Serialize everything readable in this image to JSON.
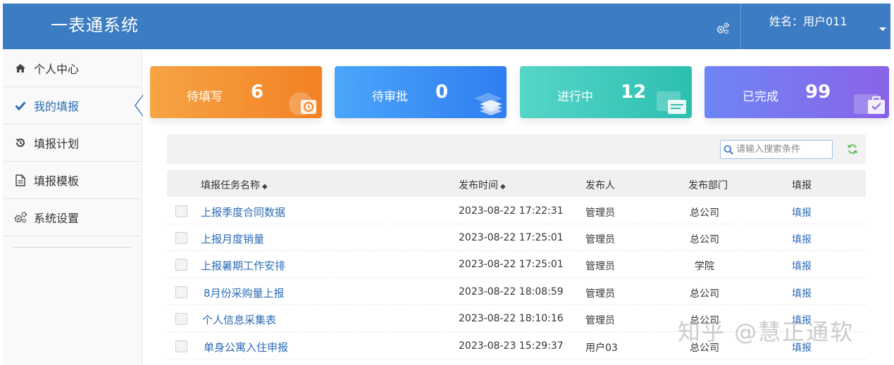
{
  "app": {
    "title": "一表通系统"
  },
  "header": {
    "user_label": "姓名：用户011",
    "settings_icon": "gears-icon"
  },
  "sidebar": {
    "items": [
      {
        "label": "个人中心",
        "icon": "home-icon"
      },
      {
        "label": "我的填报",
        "icon": "check-icon",
        "active": true
      },
      {
        "label": "填报计划",
        "icon": "history-icon"
      },
      {
        "label": "填报模板",
        "icon": "document-icon"
      },
      {
        "label": "系统设置",
        "icon": "gears-icon"
      }
    ]
  },
  "stats": [
    {
      "label": "待填写",
      "value": "6",
      "icon": "clock-icon",
      "color": "#f28124"
    },
    {
      "label": "待审批",
      "value": "0",
      "icon": "layers-icon",
      "color": "#2f7df0"
    },
    {
      "label": "进行中",
      "value": "12",
      "icon": "window-icon",
      "color": "#2cbfb0"
    },
    {
      "label": "已完成",
      "value": "99",
      "icon": "briefcase-icon",
      "color": "#8a63e8"
    }
  ],
  "search": {
    "placeholder": "请输入搜索条件"
  },
  "table": {
    "columns": [
      "填报任务名称",
      "发布时间",
      "发布人",
      "发布部门",
      "填报"
    ],
    "rows": [
      {
        "name": "上报季度合同数据",
        "time": "2023-08-22 17:22:31",
        "publisher": "管理员",
        "dept": "总公司",
        "action": "填报"
      },
      {
        "name": "上报月度销量",
        "time": "2023-08-22 17:25:01",
        "publisher": "管理员",
        "dept": "总公司",
        "action": "填报"
      },
      {
        "name": "上报暑期工作安排",
        "time": "2023-08-22 17:25:01",
        "publisher": "管理员",
        "dept": "学院",
        "action": "填报"
      },
      {
        "name": "8月份采购量上报",
        "time": "2023-08-22 18:08:59",
        "publisher": "管理员",
        "dept": "总公司",
        "action": "填报"
      },
      {
        "name": "个人信息采集表",
        "time": "2023-08-22 18:10:16",
        "publisher": "管理员",
        "dept": "总公司",
        "action": "填报"
      },
      {
        "name": "单身公寓入住申报",
        "time": "2023-08-23 15:29:37",
        "publisher": "用户03",
        "dept": "总公司",
        "action": "填报"
      }
    ]
  },
  "watermark": "知乎 @慧正通软"
}
